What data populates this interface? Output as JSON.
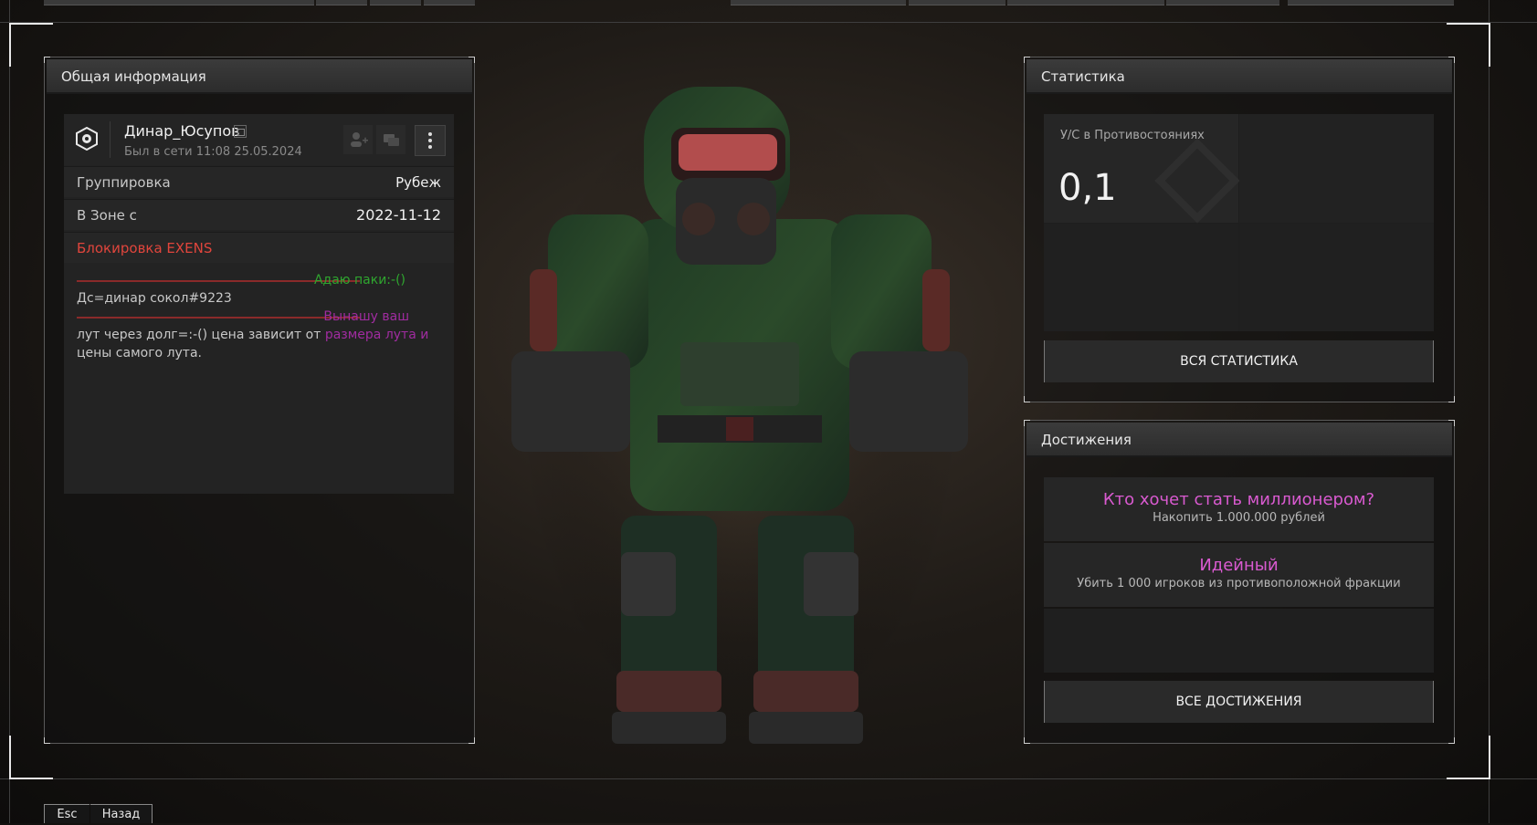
{
  "left_panel": {
    "title": "Общая информация",
    "player": {
      "name": "Динар_Юсупов",
      "last_seen": "Был в сети 11:08 25.05.2024"
    },
    "rows": [
      {
        "key": "Группировка",
        "value": "Рубеж"
      },
      {
        "key": "В Зоне с",
        "value": "2022-11-12"
      }
    ],
    "ban_label": "Блокировка EXENS",
    "bio": {
      "line1_green": "Адаю паки:-()",
      "line2": "Дс=динар сокол#9223",
      "line3_purple": "Вынашу ваш",
      "line4_start": "лут через долг=:-() цена зависит от ",
      "line4_purple": "размера лута и",
      "line5": "цены самого лута."
    }
  },
  "stats_panel": {
    "title": "Статистика",
    "metric_label": "У/С в Противостояниях",
    "metric_value": "0,1",
    "all_button": "ВСЯ СТАТИСТИКА"
  },
  "achievements_panel": {
    "title": "Достижения",
    "items": [
      {
        "title": "Кто хочет стать миллионером?",
        "desc": "Накопить 1.000.000 рублей"
      },
      {
        "title": "Идейный",
        "desc": "Убить 1 000 игроков из противоположной фракции"
      }
    ],
    "all_button": "ВСЕ ДОСТИЖЕНИЯ"
  },
  "footer": {
    "esc_key": "Esc",
    "back_label": "Назад"
  },
  "colors": {
    "ban_red": "#e0453c",
    "bio_green": "#2fa62f",
    "bio_purple": "#a02ca0",
    "achievement_pink": "#d95ad0"
  },
  "icons": [
    "faction-emblem-icon",
    "copy-icon",
    "add-friend-icon",
    "message-icon",
    "more-vertical-icon"
  ]
}
